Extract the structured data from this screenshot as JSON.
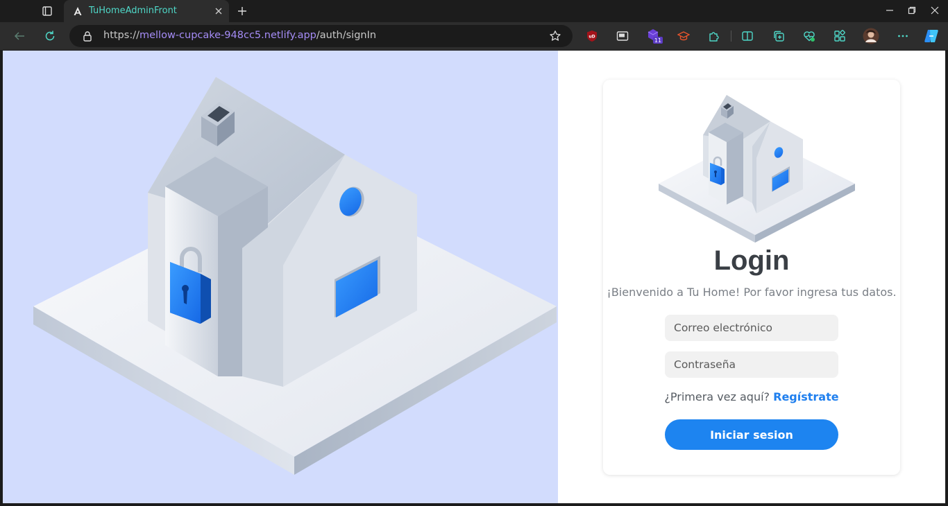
{
  "browser": {
    "tab": {
      "title": "TuHomeAdminFront"
    },
    "address": {
      "scheme": "https://",
      "host": "mellow-cupcake-948cc5.netlify.app",
      "path": "/auth/signIn"
    },
    "extension_badge": "11",
    "accent_color": "#a58cf6"
  },
  "login": {
    "title": "Login",
    "subtitle": "¡Bienvenido a Tu Home! Por favor ingresa tus datos.",
    "email_placeholder": "Correo electrónico",
    "password_placeholder": "Contraseña",
    "register_prompt": "¿Primera vez aquí?",
    "register_link": "Regístrate",
    "submit_label": "Iniciar sesion",
    "button_color": "#1d84f0",
    "hero_background": "#d2dcfd"
  }
}
